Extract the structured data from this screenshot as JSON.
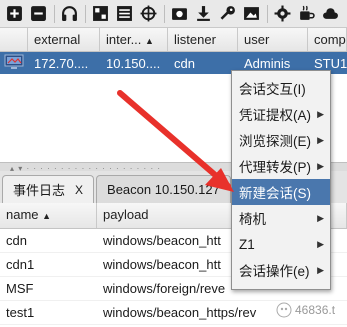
{
  "toolbar": {
    "icons": [
      "plus-icon",
      "minus-icon",
      "headset-icon",
      "grid-icon",
      "list-icon",
      "crosshair-icon",
      "image-icon",
      "download-icon",
      "key-icon",
      "picture-icon",
      "gear-icon",
      "coffee-icon",
      "cloud-icon"
    ]
  },
  "top_table": {
    "columns": [
      "",
      "external",
      "inter...",
      "listener",
      "user",
      "comp"
    ],
    "sort_column_index": 2,
    "rows": [
      {
        "external": "172.70....",
        "internal": "10.150....",
        "listener": "cdn",
        "user": "Adminis",
        "computer": "STU1"
      }
    ]
  },
  "tabs": [
    {
      "label": "事件日志",
      "close": "X",
      "active": true
    },
    {
      "label": "Beacon 10.150.127",
      "close": "",
      "active": false
    }
  ],
  "bottom_table": {
    "columns": [
      "name",
      "payload"
    ],
    "rows": [
      {
        "name": "cdn",
        "payload": "windows/beacon_htt"
      },
      {
        "name": "cdn1",
        "payload": "windows/beacon_htt"
      },
      {
        "name": "MSF",
        "payload": "windows/foreign/reve"
      },
      {
        "name": "test1",
        "payload": "windows/beacon_https/rev"
      }
    ]
  },
  "context_menu": {
    "items": [
      {
        "label": "会话交互(I)",
        "submenu": false,
        "highlighted": false
      },
      {
        "label": "凭证提权(A)",
        "submenu": true,
        "highlighted": false
      },
      {
        "label": "浏览探测(E)",
        "submenu": true,
        "highlighted": false
      },
      {
        "label": "代理转发(P)",
        "submenu": true,
        "highlighted": false
      },
      {
        "label": "新建会话(S)",
        "submenu": false,
        "highlighted": true
      },
      {
        "label": "椅机",
        "submenu": true,
        "highlighted": false
      },
      {
        "label": "Z1",
        "submenu": true,
        "highlighted": false
      },
      {
        "label": "会话操作(e)",
        "submenu": true,
        "highlighted": false
      }
    ]
  },
  "watermark": {
    "text": "46836.t"
  },
  "colors": {
    "selection": "#3d6fa8",
    "menu_highlight": "#4a77ad",
    "arrow": "#e8312b"
  }
}
